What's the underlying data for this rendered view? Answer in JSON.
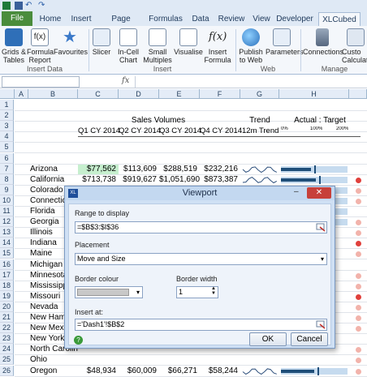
{
  "qat": {
    "icons": [
      "excel-icon",
      "save-icon",
      "undo-icon",
      "redo-icon"
    ]
  },
  "tabs": [
    "File",
    "Home",
    "Insert",
    "Page Layout",
    "Formulas",
    "Data",
    "Review",
    "View",
    "Developer",
    "XLCubed"
  ],
  "ribbon": {
    "buttons": [
      {
        "label": "Grids &\nTables",
        "icon": "grid-icon"
      },
      {
        "label": "Formula\nReport",
        "icon": "formula-icon"
      },
      {
        "label": "Favourites",
        "icon": "star-icon"
      },
      {
        "label": "Slicer",
        "icon": "slicer-icon"
      },
      {
        "label": "In-Cell\nChart",
        "icon": "incell-chart-icon"
      },
      {
        "label": "Small\nMultiples",
        "icon": "small-multiples-icon"
      },
      {
        "label": "Visualise",
        "icon": "visualise-icon"
      },
      {
        "label": "Insert\nFormula",
        "icon": "fx-icon"
      },
      {
        "label": "Publish\nto Web",
        "icon": "publish-icon"
      },
      {
        "label": "Parameters",
        "icon": "parameters-icon"
      },
      {
        "label": "Connections",
        "icon": "connections-icon"
      },
      {
        "label": "Custo\nCalculat",
        "icon": "calc-icon"
      }
    ],
    "groups": [
      "Insert Data",
      "Insert",
      "Web",
      "Manage"
    ]
  },
  "formula_bar": {
    "fx": "fx"
  },
  "columns": [
    "A",
    "B",
    "C",
    "D",
    "E",
    "F",
    "G",
    "H"
  ],
  "rows": [
    "1",
    "2",
    "3",
    "4",
    "5",
    "6",
    "7",
    "8",
    "9",
    "10",
    "11",
    "12",
    "13",
    "14",
    "15",
    "16",
    "17",
    "18",
    "19",
    "20",
    "21",
    "22",
    "23",
    "24",
    "25",
    "26"
  ],
  "header": {
    "group": "Sales Volumes",
    "trend": "Trend",
    "actual_target": "Actual : Target",
    "q1": "Q1 CY 2014",
    "q2": "Q2 CY 2014",
    "q3": "Q3 CY 2014",
    "q4": "Q4 CY 2014",
    "trend12": "12m Trend",
    "scale": [
      "0%",
      "100%",
      "200%"
    ]
  },
  "data_rows": [
    {
      "state": "Arizona",
      "q1": "$77,562",
      "q2": "$113,609",
      "q3": "$288,519",
      "q4": "$232,216",
      "ratio": 0.45,
      "dot": "none"
    },
    {
      "state": "California",
      "q1": "$713,738",
      "q2": "$919,627",
      "q3": "$1,051,690",
      "q4": "$873,387",
      "ratio": 0.52,
      "dot": "#e0403c"
    },
    {
      "state": "Colorado",
      "q1": "$240,352",
      "q2": "$271,714",
      "q3": "$315,552",
      "q4": "$259,110",
      "ratio": 0.6,
      "dot": "#f2b3ab"
    },
    {
      "state": "Connecticut",
      "q1": "$101,525",
      "q2": "$122,742",
      "q3": "$128,176",
      "q4": "$109,979",
      "ratio": 0.55,
      "dot": "#f2b3ab"
    },
    {
      "state": "Florida",
      "q1": "",
      "q2": "",
      "q3": "",
      "q4": "",
      "ratio": 0,
      "dot": "none"
    },
    {
      "state": "Georgia",
      "q1": "",
      "q2": "",
      "q3": "",
      "q4": "",
      "ratio": 0,
      "dot": "#f2b3ab"
    },
    {
      "state": "Illinois",
      "q1": "",
      "q2": "",
      "q3": "",
      "q4": "",
      "ratio": 0,
      "dot": "#f2b3ab"
    },
    {
      "state": "Indiana",
      "q1": "",
      "q2": "",
      "q3": "",
      "q4": "",
      "ratio": 0,
      "dot": "#e0403c"
    },
    {
      "state": "Maine",
      "q1": "",
      "q2": "",
      "q3": "",
      "q4": "",
      "ratio": 0,
      "dot": "#f2b3ab"
    },
    {
      "state": "Michigan",
      "q1": "",
      "q2": "",
      "q3": "",
      "q4": "",
      "ratio": 0,
      "dot": "none"
    },
    {
      "state": "Minnesota",
      "q1": "",
      "q2": "",
      "q3": "",
      "q4": "",
      "ratio": 0,
      "dot": "#f2b3ab"
    },
    {
      "state": "Mississippi",
      "q1": "",
      "q2": "",
      "q3": "",
      "q4": "",
      "ratio": 0,
      "dot": "#f2b3ab"
    },
    {
      "state": "Missouri",
      "q1": "",
      "q2": "",
      "q3": "",
      "q4": "",
      "ratio": 0,
      "dot": "#e0403c"
    },
    {
      "state": "Nevada",
      "q1": "",
      "q2": "",
      "q3": "",
      "q4": "",
      "ratio": 0,
      "dot": "#f2b3ab"
    },
    {
      "state": "New Hampsh",
      "q1": "",
      "q2": "",
      "q3": "",
      "q4": "",
      "ratio": 0,
      "dot": "#f2b3ab"
    },
    {
      "state": "New Mexico",
      "q1": "",
      "q2": "",
      "q3": "",
      "q4": "",
      "ratio": 0,
      "dot": "#f2b3ab"
    },
    {
      "state": "New York",
      "q1": "",
      "q2": "",
      "q3": "",
      "q4": "",
      "ratio": 0,
      "dot": "none"
    },
    {
      "state": "North Carolin",
      "q1": "",
      "q2": "",
      "q3": "",
      "q4": "",
      "ratio": 0,
      "dot": "#f2b3ab"
    },
    {
      "state": "Ohio",
      "q1": "",
      "q2": "",
      "q3": "",
      "q4": "",
      "ratio": 0,
      "dot": "#f2b3ab"
    },
    {
      "state": "Oregon",
      "q1": "$48,934",
      "q2": "$60,009",
      "q3": "$66,271",
      "q4": "$58,244",
      "ratio": 0.5,
      "dot": "#f2b3ab"
    }
  ],
  "dialog": {
    "title": "Viewport",
    "range_label": "Range to display",
    "range_value": "=$B$3:$I$36",
    "placement_label": "Placement",
    "placement_value": "Move and Size",
    "border_colour_label": "Border colour",
    "border_width_label": "Border width",
    "border_width_value": "1",
    "insert_at_label": "Insert at:",
    "insert_at_value": "='Dash1'!$B$2",
    "ok": "OK",
    "cancel": "Cancel",
    "help_icon": "help-icon",
    "app_icon": "xl-icon"
  }
}
